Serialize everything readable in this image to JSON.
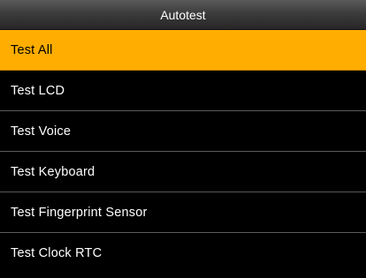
{
  "screen": {
    "title": "Autotest",
    "selected_index": 0,
    "accent_color": "#ffad00",
    "items": [
      {
        "label": "Test All"
      },
      {
        "label": "Test LCD"
      },
      {
        "label": "Test Voice"
      },
      {
        "label": "Test Keyboard"
      },
      {
        "label": "Test Fingerprint Sensor"
      },
      {
        "label": "Test Clock RTC"
      }
    ]
  }
}
